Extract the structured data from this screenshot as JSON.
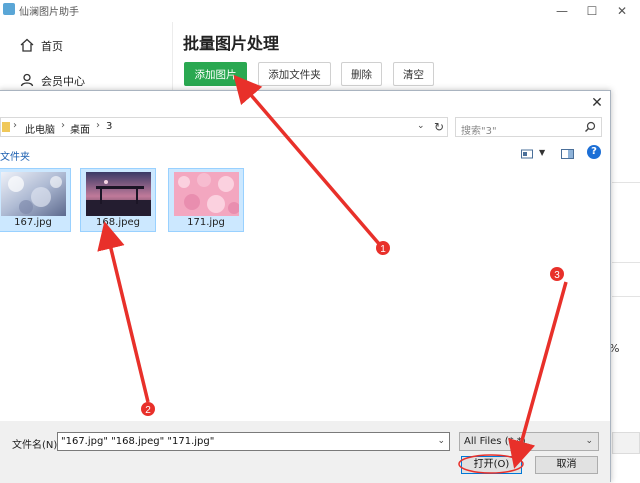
{
  "app": {
    "title": "仙澜图片助手"
  },
  "window_controls": {
    "minimize": "—",
    "maximize": "☐",
    "close": "✕"
  },
  "sidebar": {
    "items": [
      {
        "label": "首页",
        "icon": "home-icon"
      },
      {
        "label": "会员中心",
        "icon": "user-icon"
      }
    ]
  },
  "main": {
    "title": "批量图片处理",
    "toolbar": {
      "add_images": "添加图片",
      "add_folder": "添加文件夹",
      "delete": "删除",
      "clear": "清空"
    },
    "peek_text": "%"
  },
  "dialog": {
    "close": "✕",
    "breadcrumb": [
      "此电脑",
      "桌面",
      "3"
    ],
    "search_placeholder": "搜索\"3\"",
    "cmdbar_label": "文件夹",
    "help": "?",
    "files": [
      {
        "name": "167.jpg"
      },
      {
        "name": "168.jpeg"
      },
      {
        "name": "171.jpg"
      }
    ],
    "filename_label": "文件名(N):",
    "filename_value": "\"167.jpg\" \"168.jpeg\" \"171.jpg\"",
    "filetype_value": "All Files (*.*)",
    "open_button": "打开(O)",
    "cancel_button": "取消"
  },
  "annotations": {
    "colors": {
      "arrow": "#e8302a"
    },
    "markers": [
      "1",
      "2",
      "3"
    ]
  },
  "colors": {
    "primary_button": "#2aa851",
    "selection": "#cce8ff",
    "help": "#1c6fd6"
  }
}
